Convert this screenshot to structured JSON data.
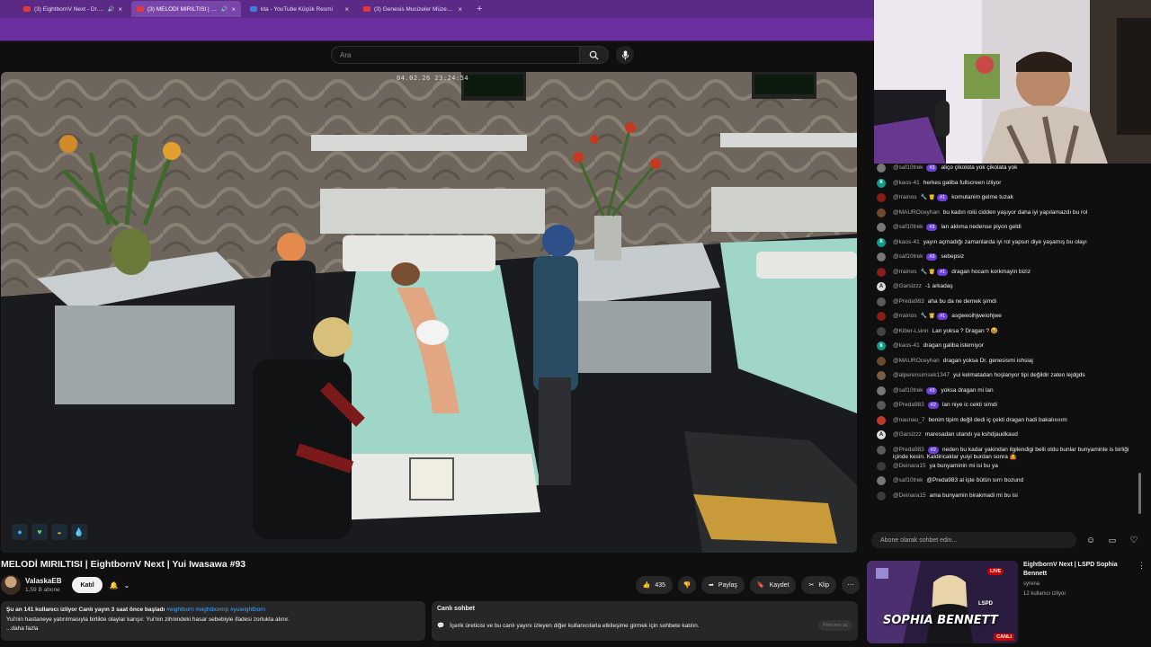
{
  "browser": {
    "tabs": [
      {
        "title": "(3) EightbornV Next - Dr. G",
        "icon": "youtube-icon",
        "audio": true
      },
      {
        "title": "(3) MELODİ MIRILTISI | Eigh",
        "icon": "youtube-icon",
        "audio": true,
        "active": true
      },
      {
        "title": "kta - YouTube Küçük Resmi",
        "icon": "tool-icon"
      },
      {
        "title": "(3) Genesis Mucizeler Müzesi -",
        "icon": "youtube-icon"
      }
    ],
    "new_tab": "+"
  },
  "search": {
    "placeholder": "Ara"
  },
  "video": {
    "timestamp": "04.02.26 23:24:54",
    "title": "MELODİ MIRILTISI | EightbornV Next | Yui Iwasawa #93"
  },
  "channel": {
    "name": "ValaskaEB",
    "subscribers": "1,59 B abone",
    "join_label": "Katıl"
  },
  "actions": {
    "likes": "435",
    "share": "Paylaş",
    "save": "Kaydet",
    "clip": "Klip"
  },
  "description": {
    "stats": "Şu an 141 kullanıcı izliyor  Canlı yayın 3 saat önce başladı",
    "tags": "#eightborn #eightbornrp #yuieightborn",
    "text": "Yui'nin hastaneye yatırılmasıyla birlikte olaylar karışır. Yui'nin zihnindeki hasar sebebiyle ifadesi zorlukla alınır.",
    "more": "...daha fazla"
  },
  "live_chat_box": {
    "title": "Canlı sohbet",
    "text": "İçerik üreticisi ve bu canlı yayını izleyen diğer kullanıcılarla etkileşime girmek için sohbete katılın.",
    "open_label": "Pencere aç"
  },
  "chat": {
    "input_placeholder": "Abone olarak sohbet edin...",
    "messages": [
      {
        "user": "@saf10trek",
        "badge": "#3",
        "text": "aliço çikolota yok çikolata yok",
        "avatar": "#777777",
        "letter": ""
      },
      {
        "user": "@kaos-41",
        "badge": "",
        "text": "herkes galiba fullscreen izliyor",
        "avatar": "#0f9d8a",
        "letter": "k"
      },
      {
        "user": "@rrainos",
        "badge": "#1",
        "text": "komutanim gelme tuzak",
        "avatar": "#8a1c1c",
        "letter": "",
        "emoji": "🔧 🤴"
      },
      {
        "user": "@MAUROceyhan",
        "badge": "",
        "text": "bu kadın rolü cidden yaşıyor daha iyi yapılamazdı bu rol",
        "avatar": "#6d4a2e",
        "letter": ""
      },
      {
        "user": "@saf10trek",
        "badge": "#3",
        "text": "lan aklıma nedense piyon geldi",
        "avatar": "#777777",
        "letter": ""
      },
      {
        "user": "@kaos-41",
        "badge": "",
        "text": "yayın açmadığı zamanlarda iyi rol yapsın diye yaşamış bu olayı",
        "avatar": "#0f9d8a",
        "letter": "k"
      },
      {
        "user": "@saf10trek",
        "badge": "#3",
        "text": "sebepsiz",
        "avatar": "#777777",
        "letter": ""
      },
      {
        "user": "@rrainos",
        "badge": "#1",
        "text": "dragan hocam korkmayin biziz",
        "avatar": "#8a1c1c",
        "letter": "",
        "emoji": "🔧 🤴"
      },
      {
        "user": "@Garsizzz",
        "badge": "",
        "text": "-1 arkadaş",
        "avatar": "#dddddd",
        "letter": "A"
      },
      {
        "user": "@Preda983",
        "badge": "",
        "text": "aha bu da ne demek şimdi",
        "avatar": "#5a5a5a",
        "letter": ""
      },
      {
        "user": "@rrainos",
        "badge": "#1",
        "text": "asgweoihjweiohjwe",
        "avatar": "#8a1c1c",
        "letter": "",
        "emoji": "🔧 🤴"
      },
      {
        "user": "@Kiber-Lsinn",
        "badge": "",
        "text": "Lan yoksa ? Dragan ? 😆",
        "avatar": "#444444",
        "letter": ""
      },
      {
        "user": "@kaos-41",
        "badge": "",
        "text": "dragan galiba istemiyor",
        "avatar": "#0f9d8a",
        "letter": "k"
      },
      {
        "user": "@MAUROceyhan",
        "badge": "",
        "text": "dragan yoksa Dr. genesismi ishsiaj",
        "avatar": "#6d4a2e",
        "letter": ""
      },
      {
        "user": "@alperensimsek1347",
        "badge": "",
        "text": "yui kelmatadan hoşlanyor tipi değildir zaten lejdgds",
        "avatar": "#7a5c44",
        "letter": ""
      },
      {
        "user": "@saf10trek",
        "badge": "#3",
        "text": "yoksa dragan mi lan",
        "avatar": "#777777",
        "letter": ""
      },
      {
        "user": "@Preda983",
        "badge": "#2",
        "text": "lan niye ic cekti simdi",
        "avatar": "#5a5a5a",
        "letter": ""
      },
      {
        "user": "@naunau_7",
        "badge": "",
        "text": "benim tipim değil dedi iç çekti dragan hadi bakalıııııım",
        "avatar": "#c0392b",
        "letter": ""
      },
      {
        "user": "@Garsizzz",
        "badge": "",
        "text": "maresadan utandı ya kshdjaudkaud",
        "avatar": "#dddddd",
        "letter": "A"
      },
      {
        "user": "@Preda983",
        "badge": "#2",
        "text": "neden bu kadar yakindan ilgilendigi belli oldu bunlar bunyaminle is birliği içinde kesin. Kaldiricaklar yuiyi burdan sonra 🤷",
        "avatar": "#5a5a5a",
        "letter": ""
      },
      {
        "user": "@Deinara15",
        "badge": "",
        "text": "ya bunyaminin mi isi bu ya",
        "avatar": "#3a3a3a",
        "letter": ""
      },
      {
        "user": "@saf10trek",
        "badge": "",
        "text": "@Preda983 al işte bütün sırrı bozund",
        "avatar": "#777777",
        "letter": ""
      },
      {
        "user": "@Deinara15",
        "badge": "",
        "text": "ama bunyamin birakmadi mi bu isi",
        "avatar": "#3a3a3a",
        "letter": ""
      }
    ]
  },
  "recommendation": {
    "title": "EightbornV Next | LSPD Sophia Bennett",
    "channel": "syrena",
    "viewers": "12 kullanıcı izliyor",
    "live_label": "CANLI",
    "live_badge": "LIVE",
    "thumb_text": "SOPHIA BENNETT",
    "thumb_sub": "LSPD"
  },
  "colors": {
    "browser_accent": "#6c2fa0",
    "badge": "#6b3fd4",
    "live": "#cc0000",
    "link": "#3ea6ff"
  }
}
